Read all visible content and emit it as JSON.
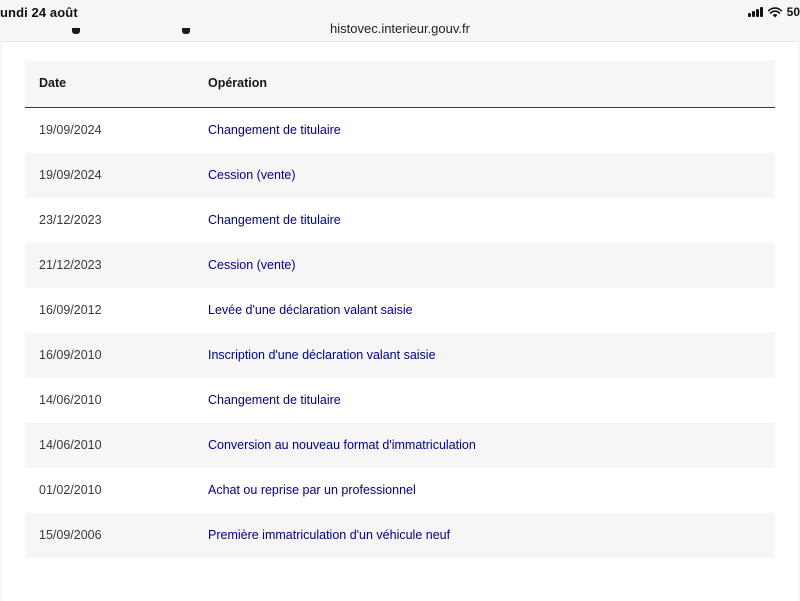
{
  "status_bar": {
    "time": "undi 24 août",
    "battery_percent": "50"
  },
  "browser": {
    "url": "histovec.interieur.gouv.fr"
  },
  "table": {
    "headers": {
      "date": "Date",
      "operation": "Opération"
    },
    "rows": [
      {
        "date": "19/09/2024",
        "operation": "Changement de titulaire"
      },
      {
        "date": "19/09/2024",
        "operation": "Cession (vente)"
      },
      {
        "date": "23/12/2023",
        "operation": "Changement de titulaire"
      },
      {
        "date": "21/12/2023",
        "operation": "Cession (vente)"
      },
      {
        "date": "16/09/2012",
        "operation": "Levée d'une déclaration valant saisie"
      },
      {
        "date": "16/09/2010",
        "operation": "Inscription d'une déclaration valant saisie"
      },
      {
        "date": "14/06/2010",
        "operation": "Changement de titulaire"
      },
      {
        "date": "14/06/2010",
        "operation": "Conversion au nouveau format d'immatriculation"
      },
      {
        "date": "01/02/2010",
        "operation": "Achat ou reprise par un professionnel"
      },
      {
        "date": "15/09/2006",
        "operation": "Première immatriculation d'un véhicule neuf"
      }
    ]
  },
  "colors": {
    "link": "#000091",
    "header_bg": "#f6f6f6",
    "row_alt_bg": "#f6f6f6"
  }
}
